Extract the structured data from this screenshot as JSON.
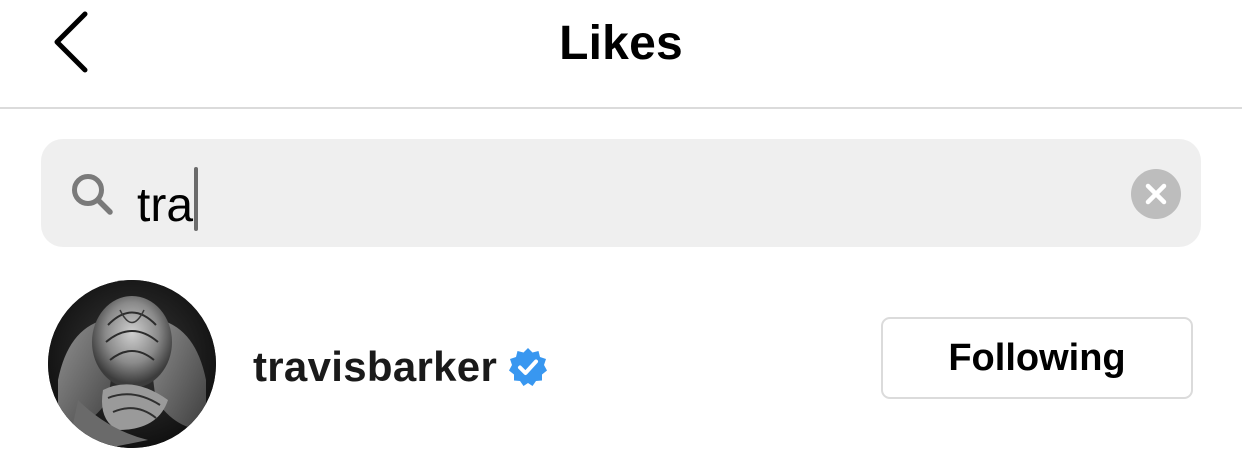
{
  "header": {
    "title": "Likes",
    "back_icon": "chevron-left-icon"
  },
  "search": {
    "value": "tra",
    "search_icon": "search-icon",
    "clear_icon": "clear-x-circle-icon"
  },
  "results": [
    {
      "username": "travisbarker",
      "verified": true,
      "verified_icon": "verified-badge-icon",
      "verified_color": "#3897f0",
      "follow_label": "Following"
    }
  ],
  "colors": {
    "divider": "#dbdbdb",
    "search_bg": "#efefef",
    "clear_bg": "#bdbdbd",
    "verified_blue": "#3897f0"
  }
}
